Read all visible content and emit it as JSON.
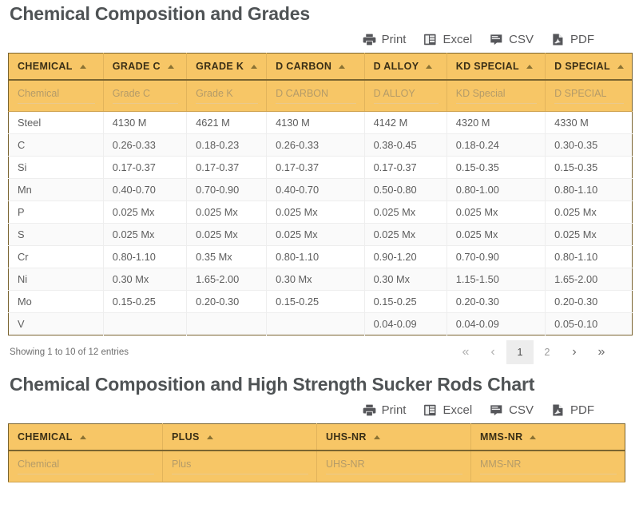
{
  "sections": [
    {
      "title": "Chemical Composition and Grades",
      "toolbar": [
        {
          "label": "Print",
          "icon": "printer-icon"
        },
        {
          "label": "Excel",
          "icon": "excel-icon"
        },
        {
          "label": "CSV",
          "icon": "csv-icon"
        },
        {
          "label": "PDF",
          "icon": "pdf-icon"
        }
      ],
      "columns": [
        {
          "label": "CHEMICAL",
          "filter_placeholder": "Chemical"
        },
        {
          "label": "GRADE C",
          "filter_placeholder": "Grade C"
        },
        {
          "label": "GRADE K",
          "filter_placeholder": "Grade K"
        },
        {
          "label": "D CARBON",
          "filter_placeholder": "D CARBON"
        },
        {
          "label": "D ALLOY",
          "filter_placeholder": "D ALLOY"
        },
        {
          "label": "KD SPECIAL",
          "filter_placeholder": "KD Special"
        },
        {
          "label": "D SPECIAL",
          "filter_placeholder": "D SPECIAL"
        }
      ],
      "rows": [
        [
          "Steel",
          "4130 M",
          "4621 M",
          "4130 M",
          "4142 M",
          "4320 M",
          "4330 M"
        ],
        [
          "C",
          "0.26-0.33",
          "0.18-0.23",
          "0.26-0.33",
          "0.38-0.45",
          "0.18-0.24",
          "0.30-0.35"
        ],
        [
          "Si",
          "0.17-0.37",
          "0.17-0.37",
          "0.17-0.37",
          "0.17-0.37",
          "0.15-0.35",
          "0.15-0.35"
        ],
        [
          "Mn",
          "0.40-0.70",
          "0.70-0.90",
          "0.40-0.70",
          "0.50-0.80",
          "0.80-1.00",
          "0.80-1.10"
        ],
        [
          "P",
          "0.025 Mx",
          "0.025 Mx",
          "0.025 Mx",
          "0.025 Mx",
          "0.025 Mx",
          "0.025 Mx"
        ],
        [
          "S",
          "0.025 Mx",
          "0.025 Mx",
          "0.025 Mx",
          "0.025 Mx",
          "0.025 Mx",
          "0.025 Mx"
        ],
        [
          "Cr",
          "0.80-1.10",
          "0.35 Mx",
          "0.80-1.10",
          "0.90-1.20",
          "0.70-0.90",
          "0.80-1.10"
        ],
        [
          "Ni",
          "0.30 Mx",
          "1.65-2.00",
          "0.30 Mx",
          "0.30 Mx",
          "1.15-1.50",
          "1.65-2.00"
        ],
        [
          "Mo",
          "0.15-0.25",
          "0.20-0.30",
          "0.15-0.25",
          "0.15-0.25",
          "0.20-0.30",
          "0.20-0.30"
        ],
        [
          "V",
          "",
          "",
          "",
          "0.04-0.09",
          "0.04-0.09",
          "0.05-0.10"
        ]
      ],
      "footer": {
        "info": "Showing 1 to 10 of 12 entries",
        "pages": [
          {
            "label": "«",
            "name": "pagination-first",
            "kind": "dbl"
          },
          {
            "label": "‹",
            "name": "pagination-prev",
            "kind": "chev"
          },
          {
            "label": "1",
            "name": "pagination-page-1",
            "kind": "active"
          },
          {
            "label": "2",
            "name": "pagination-page-2",
            "kind": "num"
          },
          {
            "label": "›",
            "name": "pagination-next",
            "kind": "chev strong"
          },
          {
            "label": "»",
            "name": "pagination-last",
            "kind": "dbl strong"
          }
        ]
      }
    },
    {
      "title": "Chemical Composition and High Strength Sucker Rods Chart",
      "toolbar": [
        {
          "label": "Print",
          "icon": "printer-icon"
        },
        {
          "label": "Excel",
          "icon": "excel-icon"
        },
        {
          "label": "CSV",
          "icon": "csv-icon"
        },
        {
          "label": "PDF",
          "icon": "pdf-icon"
        }
      ],
      "columns": [
        {
          "label": "CHEMICAL",
          "filter_placeholder": "Chemical"
        },
        {
          "label": "PLUS",
          "filter_placeholder": "Plus"
        },
        {
          "label": "UHS-NR",
          "filter_placeholder": "UHS-NR"
        },
        {
          "label": "MMS-NR",
          "filter_placeholder": "MMS-NR"
        }
      ],
      "rows": []
    }
  ],
  "colors": {
    "header_bg": "#f7c666",
    "header_text": "#3a2f16",
    "table_border": "#7a6430",
    "title_text": "#4f5355",
    "row_alt_bg": "#fafafa",
    "pager_active_bg": "#ededed"
  }
}
